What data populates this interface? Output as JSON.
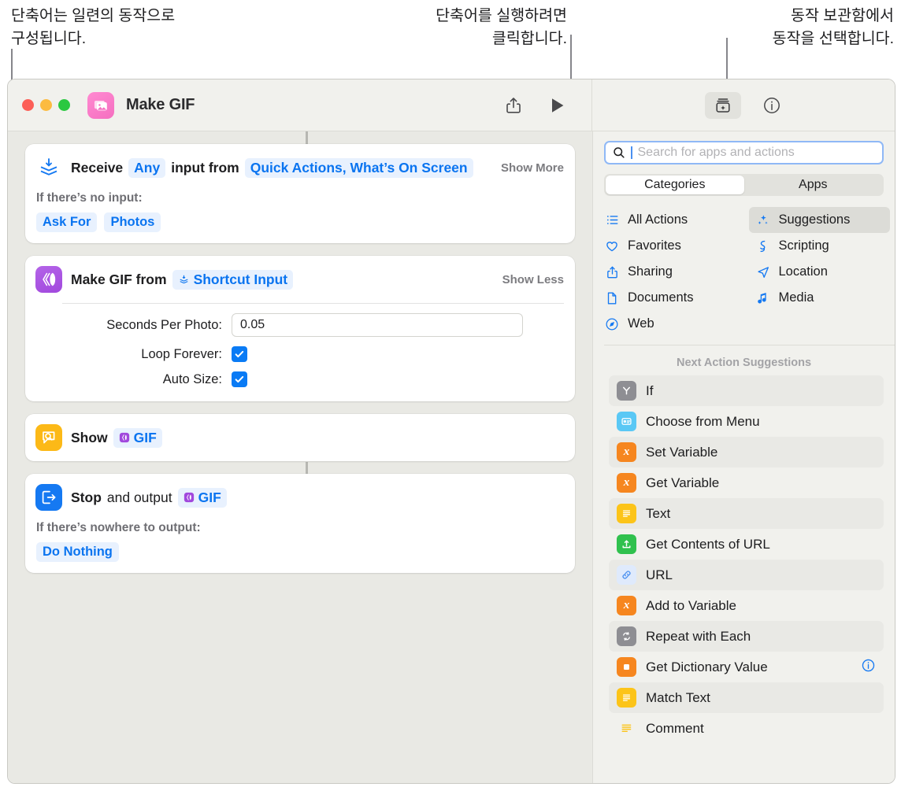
{
  "callouts": [
    {
      "id": "callout-1",
      "text": "단축어는 일련의 동작으로\n구성됩니다."
    },
    {
      "id": "callout-2",
      "text": "단축어를 실행하려면\n클릭합니다."
    },
    {
      "id": "callout-3",
      "text": "동작 보관함에서\n동작을 선택합니다."
    }
  ],
  "window": {
    "title": "Make GIF",
    "app_icon": "photos-stack-icon",
    "toolbar": {
      "share_label": "share-icon",
      "play_label": "play-icon",
      "library_label": "action-library-icon",
      "info_label": "info-icon"
    }
  },
  "editor": {
    "actions": [
      {
        "icon": "receive-input-icon",
        "title_parts": [
          {
            "type": "text",
            "value": "Receive"
          },
          {
            "type": "token",
            "value": "Any"
          },
          {
            "type": "text",
            "value": "input from"
          },
          {
            "type": "token",
            "value": "Quick Actions, What’s On Screen"
          }
        ],
        "toggle": "Show More",
        "sub_label": "If there’s no input:",
        "chips": [
          "Ask For",
          "Photos"
        ]
      },
      {
        "icon": "make-gif-icon",
        "title_parts": [
          {
            "type": "text",
            "value": "Make GIF from"
          },
          {
            "type": "token",
            "value": "Shortcut Input",
            "glyph": "shortcut-input-icon"
          }
        ],
        "toggle": "Show Less",
        "params": [
          {
            "label": "Seconds Per Photo:",
            "type": "text",
            "value": "0.05"
          },
          {
            "label": "Loop Forever:",
            "type": "checkbox",
            "value": true
          },
          {
            "label": "Auto Size:",
            "type": "checkbox",
            "value": true
          }
        ]
      },
      {
        "icon": "show-result-icon",
        "title_parts": [
          {
            "type": "text",
            "value": "Show"
          },
          {
            "type": "token",
            "value": "GIF",
            "glyph": "gif-variable-icon"
          }
        ]
      },
      {
        "icon": "stop-and-output-icon",
        "title_parts": [
          {
            "type": "text",
            "value": "Stop"
          },
          {
            "type": "text",
            "value": "and output"
          },
          {
            "type": "token",
            "value": "GIF",
            "glyph": "gif-variable-icon"
          }
        ],
        "sub_label": "If there’s nowhere to output:",
        "chips": [
          "Do Nothing"
        ]
      }
    ]
  },
  "sidebar": {
    "search": {
      "placeholder": "Search for apps and actions",
      "value": ""
    },
    "segments": [
      {
        "label": "Categories",
        "active": true
      },
      {
        "label": "Apps",
        "active": false
      }
    ],
    "categories_left": [
      {
        "label": "All Actions",
        "icon": "list-bullet-icon",
        "selected": false
      },
      {
        "label": "Favorites",
        "icon": "heart-icon",
        "selected": false
      },
      {
        "label": "Sharing",
        "icon": "share-icon",
        "selected": false
      },
      {
        "label": "Documents",
        "icon": "document-icon",
        "selected": false
      },
      {
        "label": "Web",
        "icon": "compass-icon",
        "selected": false
      }
    ],
    "categories_right": [
      {
        "label": "Suggestions",
        "icon": "sparkles-icon",
        "selected": true
      },
      {
        "label": "Scripting",
        "icon": "scripting-icon",
        "selected": false
      },
      {
        "label": "Location",
        "icon": "location-arrow-icon",
        "selected": false
      },
      {
        "label": "Media",
        "icon": "music-note-icon",
        "selected": false
      }
    ],
    "suggestions_title": "Next Action Suggestions",
    "suggestions": [
      {
        "label": "If",
        "icon": "if-icon",
        "color": "#8e8e93",
        "glyph": "Y",
        "alt": true,
        "info": false
      },
      {
        "label": "Choose from Menu",
        "icon": "menu-icon",
        "color": "#5ac8f5",
        "glyph": "▤",
        "alt": false,
        "info": false
      },
      {
        "label": "Set Variable",
        "icon": "variable-icon",
        "color": "#f6861f",
        "glyph": "x",
        "alt": true,
        "info": false
      },
      {
        "label": "Get Variable",
        "icon": "variable-icon",
        "color": "#f6861f",
        "glyph": "x",
        "alt": false,
        "info": false
      },
      {
        "label": "Text",
        "icon": "text-icon",
        "color": "#fdc game",
        "glyph": "≡",
        "alt": true,
        "info": false
      },
      {
        "label": "Get Contents of URL",
        "icon": "download-icon",
        "color": "#30c14e",
        "glyph": "⤓",
        "alt": false,
        "info": false
      },
      {
        "label": "URL",
        "icon": "link-icon",
        "color": "#dfeafc",
        "glyph": "🔗",
        "alt": true,
        "info": false
      },
      {
        "label": "Add to Variable",
        "icon": "variable-icon",
        "color": "#f6861f",
        "glyph": "x",
        "alt": false,
        "info": false
      },
      {
        "label": "Repeat with Each",
        "icon": "repeat-icon",
        "color": "#8e8e93",
        "glyph": "↻",
        "alt": true,
        "info": false
      },
      {
        "label": "Get Dictionary Value",
        "icon": "dictionary-icon",
        "color": "#f6861f",
        "glyph": "◻",
        "alt": false,
        "info": true
      },
      {
        "label": "Match Text",
        "icon": "text-icon",
        "color": "#fcc419",
        "glyph": "≡",
        "alt": true,
        "info": false
      },
      {
        "label": "Comment",
        "icon": "comment-icon",
        "color": "transparent",
        "glyph": "≡",
        "alt": false,
        "info": false
      }
    ]
  },
  "colors": {
    "accent_blue": "#0a74f0",
    "token_bg": "#e8f1fe",
    "window_chrome": "#f1f1ed",
    "editor_bg": "#e9e9e4",
    "selected_row": "#dcdcd7"
  }
}
